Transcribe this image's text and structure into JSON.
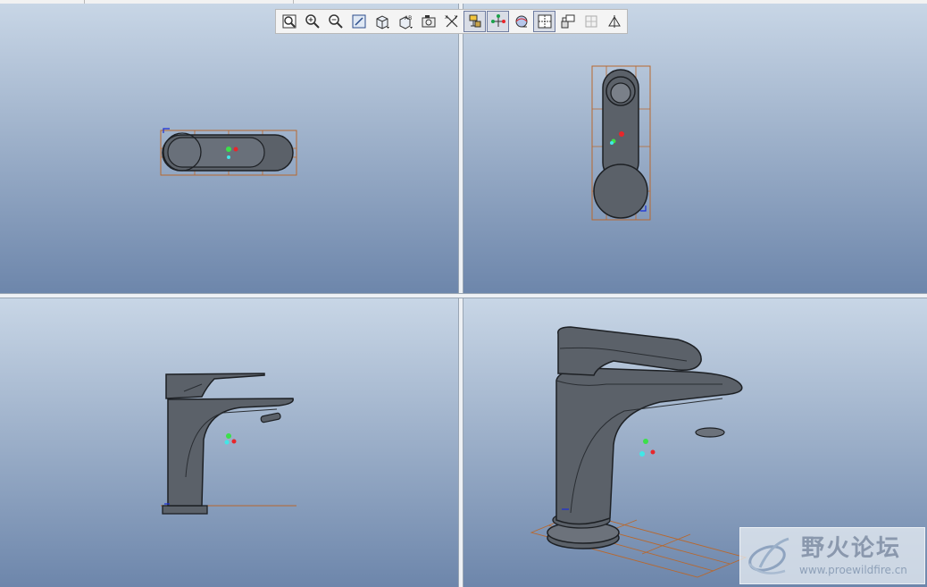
{
  "toolbar": {
    "buttons": [
      {
        "icon": "refit-icon",
        "active": false
      },
      {
        "icon": "zoom-in-icon",
        "active": false
      },
      {
        "icon": "zoom-out-icon",
        "active": false
      },
      {
        "icon": "repaint-icon",
        "active": false
      },
      {
        "icon": "saved-views-icon",
        "active": false
      },
      {
        "icon": "named-view-icon",
        "active": false
      },
      {
        "icon": "layers-icon",
        "active": false
      },
      {
        "icon": "coordinate-display-icon",
        "active": false
      },
      {
        "icon": "datum-planes-icon",
        "active": true
      },
      {
        "icon": "datum-axes-icon",
        "active": true
      },
      {
        "icon": "spin-center-icon",
        "active": false
      },
      {
        "icon": "multi-viewport-icon",
        "active": true
      },
      {
        "icon": "orient-icon",
        "active": false
      },
      {
        "icon": "grid-icon",
        "active": false
      },
      {
        "icon": "section-icon",
        "active": false
      }
    ]
  },
  "viewports": [
    {
      "name": "top-view"
    },
    {
      "name": "front-view"
    },
    {
      "name": "left-view"
    },
    {
      "name": "isometric-view"
    }
  ],
  "colors": {
    "model_fill": "#5b6169",
    "model_edge": "#1d2024",
    "bounding_box": "#b8682e",
    "axis_red": "#e8262b",
    "axis_green": "#3be04a",
    "axis_cyan": "#41e7e7"
  },
  "watermark": {
    "title": "野火论坛",
    "url": "www.proewildfire.cn"
  }
}
